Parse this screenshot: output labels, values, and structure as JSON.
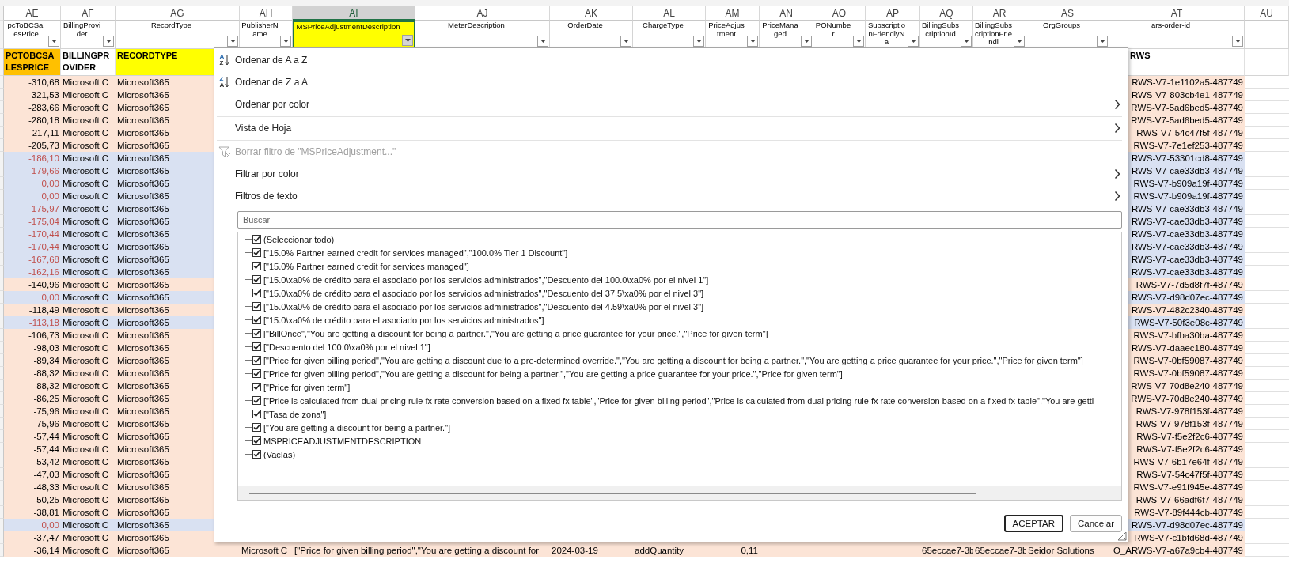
{
  "columns": [
    {
      "letter": "AE",
      "header": "pcToBCSalesPrice",
      "selected": false
    },
    {
      "letter": "AF",
      "header": "BillingProvider",
      "selected": false
    },
    {
      "letter": "AG",
      "header": "RecordType",
      "selected": false
    },
    {
      "letter": "AH",
      "header": "PublisherName",
      "selected": false
    },
    {
      "letter": "AI",
      "header": "MSPriceAdjustmentDescription",
      "selected": true
    },
    {
      "letter": "AJ",
      "header": "MeterDescription",
      "selected": false
    },
    {
      "letter": "AK",
      "header": "OrderDate",
      "selected": false
    },
    {
      "letter": "AL",
      "header": "ChargeType",
      "selected": false
    },
    {
      "letter": "AM",
      "header": "PriceAdjustment",
      "selected": false
    },
    {
      "letter": "AN",
      "header": "PriceManaged",
      "selected": false
    },
    {
      "letter": "AO",
      "header": "PONumber",
      "selected": false
    },
    {
      "letter": "AP",
      "header": "SubscriptionFriendlyNa",
      "selected": false
    },
    {
      "letter": "AQ",
      "header": "BillingSubscriptionId",
      "selected": false
    },
    {
      "letter": "AR",
      "header": "BillingSubscriptionFriendl",
      "selected": false
    },
    {
      "letter": "AS",
      "header": "OrgGroups",
      "selected": false
    },
    {
      "letter": "AT",
      "header": "ars-order-id",
      "selected": false
    },
    {
      "letter": "AU",
      "selected": false
    }
  ],
  "title_row": {
    "AE": {
      "text": "PCTOBCSALESPRICE",
      "color": "#ffc000"
    },
    "AF": {
      "text": "BILLINGPROVIDER",
      "color": "#ffffff"
    },
    "AG": {
      "text": "RECORDTYPE",
      "color": "#ffff00"
    },
    "AT": {
      "text": "RWS",
      "color": "#ffffff"
    }
  },
  "rows": [
    {
      "color": "#fce4d6",
      "alert": false,
      "cells": {
        "AE": "-310,68",
        "AF": "Microsoft C",
        "AG": "Microsoft365",
        "AT": "RWS-V7-1e1102a5-487749"
      }
    },
    {
      "color": "#fce4d6",
      "alert": false,
      "cells": {
        "AE": "-321,53",
        "AF": "Microsoft C",
        "AG": "Microsoft365",
        "AT": "RWS-V7-803cb4e1-487749"
      }
    },
    {
      "color": "#fce4d6",
      "alert": false,
      "cells": {
        "AE": "-283,66",
        "AF": "Microsoft C",
        "AG": "Microsoft365",
        "AT": "RWS-V7-5ad6bed5-487749"
      }
    },
    {
      "color": "#fce4d6",
      "alert": false,
      "cells": {
        "AE": "-280,18",
        "AF": "Microsoft C",
        "AG": "Microsoft365",
        "AT": "RWS-V7-5ad6bed5-487749"
      }
    },
    {
      "color": "#fce4d6",
      "alert": false,
      "cells": {
        "AE": "-217,11",
        "AF": "Microsoft C",
        "AG": "Microsoft365",
        "AT": "RWS-V7-54c47f5f-487749"
      }
    },
    {
      "color": "#fce4d6",
      "alert": false,
      "cells": {
        "AE": "-205,73",
        "AF": "Microsoft C",
        "AG": "Microsoft365",
        "AT": "RWS-V7-7e1ef253-487749"
      }
    },
    {
      "color": "#d9e1f2",
      "alert": true,
      "cells": {
        "AE": "-186,10",
        "AF": "Microsoft C",
        "AG": "Microsoft365",
        "AT": "RWS-V7-53301cd8-487749"
      }
    },
    {
      "color": "#d9e1f2",
      "alert": true,
      "cells": {
        "AE": "-179,66",
        "AF": "Microsoft C",
        "AG": "Microsoft365",
        "AT": "RWS-V7-cae33db3-487749"
      }
    },
    {
      "color": "#d9e1f2",
      "alert": true,
      "cells": {
        "AE": "0,00",
        "AF": "Microsoft C",
        "AG": "Microsoft365",
        "AT": "RWS-V7-b909a19f-487749"
      }
    },
    {
      "color": "#d9e1f2",
      "alert": true,
      "cells": {
        "AE": "0,00",
        "AF": "Microsoft C",
        "AG": "Microsoft365",
        "AT": "RWS-V7-b909a19f-487749"
      }
    },
    {
      "color": "#d9e1f2",
      "alert": true,
      "cells": {
        "AE": "-175,97",
        "AF": "Microsoft C",
        "AG": "Microsoft365",
        "AT": "RWS-V7-cae33db3-487749"
      }
    },
    {
      "color": "#d9e1f2",
      "alert": true,
      "cells": {
        "AE": "-175,04",
        "AF": "Microsoft C",
        "AG": "Microsoft365",
        "AT": "RWS-V7-cae33db3-487749"
      }
    },
    {
      "color": "#d9e1f2",
      "alert": true,
      "cells": {
        "AE": "-170,44",
        "AF": "Microsoft C",
        "AG": "Microsoft365",
        "AT": "RWS-V7-cae33db3-487749"
      }
    },
    {
      "color": "#d9e1f2",
      "alert": true,
      "cells": {
        "AE": "-170,44",
        "AF": "Microsoft C",
        "AG": "Microsoft365",
        "AT": "RWS-V7-cae33db3-487749"
      }
    },
    {
      "color": "#d9e1f2",
      "alert": true,
      "cells": {
        "AE": "-167,68",
        "AF": "Microsoft C",
        "AG": "Microsoft365",
        "AT": "RWS-V7-cae33db3-487749"
      }
    },
    {
      "color": "#d9e1f2",
      "alert": true,
      "cells": {
        "AE": "-162,16",
        "AF": "Microsoft C",
        "AG": "Microsoft365",
        "AT": "RWS-V7-cae33db3-487749"
      }
    },
    {
      "color": "#fce4d6",
      "alert": false,
      "cells": {
        "AE": "-140,96",
        "AF": "Microsoft C",
        "AG": "Microsoft365",
        "AT": "RWS-V7-7d5d8f7f-487749"
      }
    },
    {
      "color": "#d9e1f2",
      "alert": true,
      "cells": {
        "AE": "0,00",
        "AF": "Microsoft C",
        "AG": "Microsoft365",
        "AT": "RWS-V7-d98d07ec-487749"
      }
    },
    {
      "color": "#fce4d6",
      "alert": false,
      "cells": {
        "AE": "-118,49",
        "AF": "Microsoft C",
        "AG": "Microsoft365",
        "AT": "RWS-V7-482c2340-487749"
      }
    },
    {
      "color": "#d9e1f2",
      "alert": true,
      "cells": {
        "AE": "-113,18",
        "AF": "Microsoft C",
        "AG": "Microsoft365",
        "AT": "RWS-V7-50f3e08c-487749"
      }
    },
    {
      "color": "#fce4d6",
      "alert": false,
      "cells": {
        "AE": "-106,73",
        "AF": "Microsoft C",
        "AG": "Microsoft365",
        "AT": "RWS-V7-bfba30ba-487749"
      }
    },
    {
      "color": "#fce4d6",
      "alert": false,
      "cells": {
        "AE": "-98,03",
        "AF": "Microsoft C",
        "AG": "Microsoft365",
        "AT": "RWS-V7-daaec180-487749"
      }
    },
    {
      "color": "#fce4d6",
      "alert": false,
      "cells": {
        "AE": "-89,34",
        "AF": "Microsoft C",
        "AG": "Microsoft365",
        "AT": "RWS-V7-0bf59087-487749"
      }
    },
    {
      "color": "#fce4d6",
      "alert": false,
      "cells": {
        "AE": "-88,32",
        "AF": "Microsoft C",
        "AG": "Microsoft365",
        "AT": "RWS-V7-0bf59087-487749"
      }
    },
    {
      "color": "#fce4d6",
      "alert": false,
      "cells": {
        "AE": "-88,32",
        "AF": "Microsoft C",
        "AG": "Microsoft365",
        "AT": "RWS-V7-70d8e240-487749"
      }
    },
    {
      "color": "#fce4d6",
      "alert": false,
      "cells": {
        "AE": "-86,25",
        "AF": "Microsoft C",
        "AG": "Microsoft365",
        "AT": "RWS-V7-70d8e240-487749"
      }
    },
    {
      "color": "#fce4d6",
      "alert": false,
      "cells": {
        "AE": "-75,96",
        "AF": "Microsoft C",
        "AG": "Microsoft365",
        "AT": "RWS-V7-978f153f-487749"
      }
    },
    {
      "color": "#fce4d6",
      "alert": false,
      "cells": {
        "AE": "-75,96",
        "AF": "Microsoft C",
        "AG": "Microsoft365",
        "AT": "RWS-V7-978f153f-487749"
      }
    },
    {
      "color": "#fce4d6",
      "alert": false,
      "cells": {
        "AE": "-57,44",
        "AF": "Microsoft C",
        "AG": "Microsoft365",
        "AT": "RWS-V7-f5e2f2c6-487749"
      }
    },
    {
      "color": "#fce4d6",
      "alert": false,
      "cells": {
        "AE": "-57,44",
        "AF": "Microsoft C",
        "AG": "Microsoft365",
        "AT": "RWS-V7-f5e2f2c6-487749"
      }
    },
    {
      "color": "#fce4d6",
      "alert": false,
      "cells": {
        "AE": "-53,42",
        "AF": "Microsoft C",
        "AG": "Microsoft365",
        "AT": "RWS-V7-6b17e64f-487749"
      }
    },
    {
      "color": "#fce4d6",
      "alert": false,
      "cells": {
        "AE": "-47,03",
        "AF": "Microsoft C",
        "AG": "Microsoft365",
        "AT": "RWS-V7-54c47f5f-487749"
      }
    },
    {
      "color": "#fce4d6",
      "alert": false,
      "cells": {
        "AE": "-48,33",
        "AF": "Microsoft C",
        "AG": "Microsoft365",
        "AT": "RWS-V7-e91f945e-487749"
      }
    },
    {
      "color": "#fce4d6",
      "alert": false,
      "cells": {
        "AE": "-50,25",
        "AF": "Microsoft C",
        "AG": "Microsoft365",
        "AT": "RWS-V7-66adf6f7-487749"
      }
    },
    {
      "color": "#fce4d6",
      "alert": false,
      "cells": {
        "AE": "-38,81",
        "AF": "Microsoft C",
        "AG": "Microsoft365",
        "AT": "RWS-V7-89f444cb-487749"
      }
    },
    {
      "color": "#d9e1f2",
      "alert": true,
      "cells": {
        "AE": "0,00",
        "AF": "Microsoft C",
        "AG": "Microsoft365",
        "AT": "RWS-V7-d98d07ec-487749"
      }
    },
    {
      "color": "#fce4d6",
      "alert": false,
      "cells": {
        "AE": "-37,47",
        "AF": "Microsoft C",
        "AG": "Microsoft365",
        "AT": "RWS-V7-c1bfd68d-487749"
      }
    },
    {
      "color": "#fce4d6",
      "alert": false,
      "cells": {
        "AE": "-36,14",
        "AF": "Microsoft C",
        "AG": "Microsoft365",
        "AH": "Microsoft C",
        "AI": "[\"Price for given billing period\",\"You are getting a discount for",
        "AK": "2024-03-19",
        "AL": "addQuantity",
        "AM": "0,11",
        "AQ": "65eccae7-3b",
        "AR": "65eccae7-3b",
        "AS": "Seidor Solutions",
        "AT": "O_ARWS-V7-a67a9cb4-487749"
      }
    }
  ],
  "filter_menu": {
    "items": [
      {
        "kind": "sort_ascending",
        "label": "Ordenar de A a Z",
        "icon_letters": [
          "A",
          "Z"
        ],
        "disabled": false,
        "separator_before": false
      },
      {
        "kind": "sort_descending",
        "label": "Ordenar de Z a A",
        "icon_letters": [
          "Z",
          "A"
        ],
        "disabled": false,
        "separator_before": false
      },
      {
        "kind": "plain",
        "label": "Ordenar por color",
        "submenu": true,
        "disabled": false,
        "separator_before": false
      },
      {
        "kind": "plain",
        "label": "Vista de Hoja",
        "submenu": true,
        "disabled": false,
        "separator_before": true
      },
      {
        "kind": "clear_filter",
        "label": "Borrar filtro de \"MSPriceAdjustment...\"",
        "disabled": true,
        "separator_before": true
      },
      {
        "kind": "plain",
        "label": "Filtrar por color",
        "submenu": true,
        "disabled": false,
        "separator_before": false
      },
      {
        "kind": "plain",
        "label": "Filtros de texto",
        "submenu": true,
        "disabled": false,
        "separator_before": false
      }
    ],
    "search": {
      "placeholder": "Buscar"
    },
    "values": [
      {
        "label": "(Seleccionar todo)",
        "checked": true
      },
      {
        "label": "[\"15.0% Partner earned credit for services managed\",\"100.0% Tier 1 Discount\"]",
        "checked": true
      },
      {
        "label": "[\"15.0% Partner earned credit for services managed\"]",
        "checked": true
      },
      {
        "label": "[\"15.0\\xa0% de crédito para el asociado por los servicios administrados\",\"Descuento del 100.0\\xa0% por el nivel 1\"]",
        "checked": true
      },
      {
        "label": "[\"15.0\\xa0% de crédito para el asociado por los servicios administrados\",\"Descuento del 37.5\\xa0% por el nivel 3\"]",
        "checked": true
      },
      {
        "label": "[\"15.0\\xa0% de crédito para el asociado por los servicios administrados\",\"Descuento del 4.59\\xa0% por el nivel 3\"]",
        "checked": true
      },
      {
        "label": "[\"15.0\\xa0% de crédito para el asociado por los servicios administrados\"]",
        "checked": true
      },
      {
        "label": "[\"BillOnce\",\"You are getting a discount for being a partner.\",\"You are getting a price guarantee for your price.\",\"Price for given term\"]",
        "checked": true
      },
      {
        "label": "[\"Descuento del 100.0\\xa0% por el nivel 1\"]",
        "checked": true
      },
      {
        "label": "[\"Price for given billing period\",\"You are getting a discount due to a pre-determined override.\",\"You are getting a discount for being a partner.\",\"You are getting a price guarantee for your price.\",\"Price for given term\"]",
        "checked": true
      },
      {
        "label": "[\"Price for given billing period\",\"You are getting a discount for being a partner.\",\"You are getting a price guarantee for your price.\",\"Price for given term\"]",
        "checked": true
      },
      {
        "label": "[\"Price for given term\"]",
        "checked": true
      },
      {
        "label": "[\"Price is calculated from dual pricing rule fx rate conversion based on a fixed fx table\",\"Price for given billing period\",\"Price is calculated from dual pricing rule fx rate conversion based on a fixed fx table\",\"You are getti",
        "checked": true
      },
      {
        "label": "[\"Tasa de zona\"]",
        "checked": true
      },
      {
        "label": "[\"You are getting a discount for being a partner.\"]",
        "checked": true
      },
      {
        "label": "MSPRICEADJUSTMENTDESCRIPTION",
        "checked": true
      },
      {
        "label": "(Vacías)",
        "checked": true
      }
    ],
    "buttons": [
      {
        "label": "ACEPTAR",
        "default": true
      },
      {
        "label": "Cancelar",
        "default": false
      }
    ]
  }
}
